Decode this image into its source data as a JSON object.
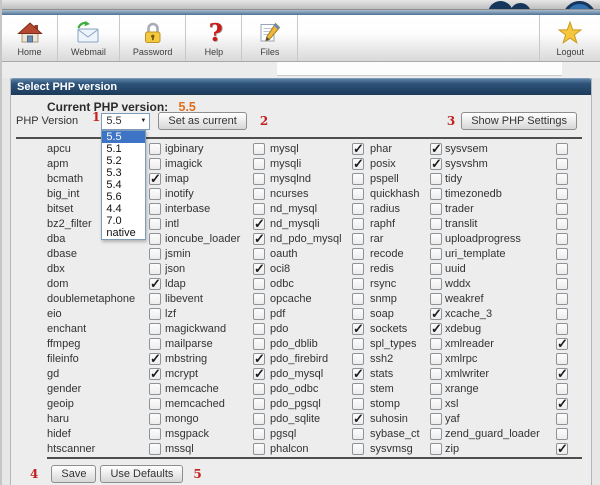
{
  "toolbar": {
    "items": [
      {
        "label": "Home",
        "icon": "home-icon"
      },
      {
        "label": "Webmail",
        "icon": "webmail-icon"
      },
      {
        "label": "Password",
        "icon": "padlock-icon"
      },
      {
        "label": "Help",
        "icon": "question-mark-icon"
      },
      {
        "label": "Files",
        "icon": "files-icon"
      }
    ],
    "logout": {
      "label": "Logout",
      "icon": "star-icon"
    }
  },
  "page": {
    "title": "Select PHP version"
  },
  "current_version": {
    "label": "Current PHP version:",
    "value": "5.5"
  },
  "version_selector": {
    "label": "PHP Version",
    "selected": "5.5",
    "options": [
      "5.5",
      "5.1",
      "5.2",
      "5.3",
      "5.4",
      "5.6",
      "4.4",
      "7.0",
      "native"
    ],
    "set_as_current_label": "Set as current",
    "show_settings_label": "Show PHP Settings"
  },
  "markers": {
    "m1": "1",
    "m2": "2",
    "m3": "3",
    "m4": "4",
    "m5": "5"
  },
  "footer": {
    "save_label": "Save",
    "use_defaults_label": "Use Defaults"
  },
  "colors": {
    "header_bar_blue": "#1b3a5a",
    "current_value_orange": "#e06d1c",
    "marker_red": "#c41f1f",
    "option_highlight_blue": "#3d74c6"
  },
  "extensions": {
    "rows": [
      [
        {
          "name": "apcu",
          "checked": false
        },
        {
          "name": "igbinary",
          "checked": false
        },
        {
          "name": "mysql",
          "checked": true
        },
        {
          "name": "phar",
          "checked": true
        },
        {
          "name": "sysvsem",
          "checked": false
        }
      ],
      [
        {
          "name": "apm",
          "checked": false
        },
        {
          "name": "imagick",
          "checked": false
        },
        {
          "name": "mysqli",
          "checked": true
        },
        {
          "name": "posix",
          "checked": true
        },
        {
          "name": "sysvshm",
          "checked": false
        }
      ],
      [
        {
          "name": "bcmath",
          "checked": true
        },
        {
          "name": "imap",
          "checked": false
        },
        {
          "name": "mysqlnd",
          "checked": false
        },
        {
          "name": "pspell",
          "checked": false
        },
        {
          "name": "tidy",
          "checked": false
        }
      ],
      [
        {
          "name": "big_int",
          "checked": false
        },
        {
          "name": "inotify",
          "checked": false
        },
        {
          "name": "ncurses",
          "checked": false
        },
        {
          "name": "quickhash",
          "checked": false
        },
        {
          "name": "timezonedb",
          "checked": false
        }
      ],
      [
        {
          "name": "bitset",
          "checked": false
        },
        {
          "name": "interbase",
          "checked": false
        },
        {
          "name": "nd_mysql",
          "checked": false
        },
        {
          "name": "radius",
          "checked": false
        },
        {
          "name": "trader",
          "checked": false
        }
      ],
      [
        {
          "name": "bz2_filter",
          "checked": false
        },
        {
          "name": "intl",
          "checked": true
        },
        {
          "name": "nd_mysqli",
          "checked": false
        },
        {
          "name": "raphf",
          "checked": false
        },
        {
          "name": "translit",
          "checked": false
        }
      ],
      [
        {
          "name": "dba",
          "checked": false
        },
        {
          "name": "ioncube_loader",
          "checked": true
        },
        {
          "name": "nd_pdo_mysql",
          "checked": false
        },
        {
          "name": "rar",
          "checked": false
        },
        {
          "name": "uploadprogress",
          "checked": false
        }
      ],
      [
        {
          "name": "dbase",
          "checked": false
        },
        {
          "name": "jsmin",
          "checked": false
        },
        {
          "name": "oauth",
          "checked": false
        },
        {
          "name": "recode",
          "checked": false
        },
        {
          "name": "uri_template",
          "checked": false
        }
      ],
      [
        {
          "name": "dbx",
          "checked": false
        },
        {
          "name": "json",
          "checked": true
        },
        {
          "name": "oci8",
          "checked": false
        },
        {
          "name": "redis",
          "checked": false
        },
        {
          "name": "uuid",
          "checked": false
        }
      ],
      [
        {
          "name": "dom",
          "checked": true
        },
        {
          "name": "ldap",
          "checked": false
        },
        {
          "name": "odbc",
          "checked": false
        },
        {
          "name": "rsync",
          "checked": false
        },
        {
          "name": "wddx",
          "checked": false
        }
      ],
      [
        {
          "name": "doublemetaphone",
          "checked": false
        },
        {
          "name": "libevent",
          "checked": false
        },
        {
          "name": "opcache",
          "checked": false
        },
        {
          "name": "snmp",
          "checked": false
        },
        {
          "name": "weakref",
          "checked": false
        }
      ],
      [
        {
          "name": "eio",
          "checked": false
        },
        {
          "name": "lzf",
          "checked": false
        },
        {
          "name": "pdf",
          "checked": false
        },
        {
          "name": "soap",
          "checked": true
        },
        {
          "name": "xcache_3",
          "checked": false
        }
      ],
      [
        {
          "name": "enchant",
          "checked": false
        },
        {
          "name": "magickwand",
          "checked": false
        },
        {
          "name": "pdo",
          "checked": true
        },
        {
          "name": "sockets",
          "checked": true
        },
        {
          "name": "xdebug",
          "checked": false
        }
      ],
      [
        {
          "name": "ffmpeg",
          "checked": false
        },
        {
          "name": "mailparse",
          "checked": false
        },
        {
          "name": "pdo_dblib",
          "checked": false
        },
        {
          "name": "spl_types",
          "checked": false
        },
        {
          "name": "xmlreader",
          "checked": true
        }
      ],
      [
        {
          "name": "fileinfo",
          "checked": true
        },
        {
          "name": "mbstring",
          "checked": true
        },
        {
          "name": "pdo_firebird",
          "checked": false
        },
        {
          "name": "ssh2",
          "checked": false
        },
        {
          "name": "xmlrpc",
          "checked": false
        }
      ],
      [
        {
          "name": "gd",
          "checked": true
        },
        {
          "name": "mcrypt",
          "checked": true
        },
        {
          "name": "pdo_mysql",
          "checked": true
        },
        {
          "name": "stats",
          "checked": false
        },
        {
          "name": "xmlwriter",
          "checked": true
        }
      ],
      [
        {
          "name": "gender",
          "checked": false
        },
        {
          "name": "memcache",
          "checked": false
        },
        {
          "name": "pdo_odbc",
          "checked": false
        },
        {
          "name": "stem",
          "checked": false
        },
        {
          "name": "xrange",
          "checked": false
        }
      ],
      [
        {
          "name": "geoip",
          "checked": false
        },
        {
          "name": "memcached",
          "checked": false
        },
        {
          "name": "pdo_pgsql",
          "checked": false
        },
        {
          "name": "stomp",
          "checked": false
        },
        {
          "name": "xsl",
          "checked": true
        }
      ],
      [
        {
          "name": "haru",
          "checked": false
        },
        {
          "name": "mongo",
          "checked": false
        },
        {
          "name": "pdo_sqlite",
          "checked": true
        },
        {
          "name": "suhosin",
          "checked": false
        },
        {
          "name": "yaf",
          "checked": false
        }
      ],
      [
        {
          "name": "hidef",
          "checked": false
        },
        {
          "name": "msgpack",
          "checked": false
        },
        {
          "name": "pgsql",
          "checked": false
        },
        {
          "name": "sybase_ct",
          "checked": false
        },
        {
          "name": "zend_guard_loader",
          "checked": false
        }
      ],
      [
        {
          "name": "htscanner",
          "checked": false
        },
        {
          "name": "mssql",
          "checked": false
        },
        {
          "name": "phalcon",
          "checked": false
        },
        {
          "name": "sysvmsg",
          "checked": false
        },
        {
          "name": "zip",
          "checked": true
        }
      ]
    ]
  }
}
